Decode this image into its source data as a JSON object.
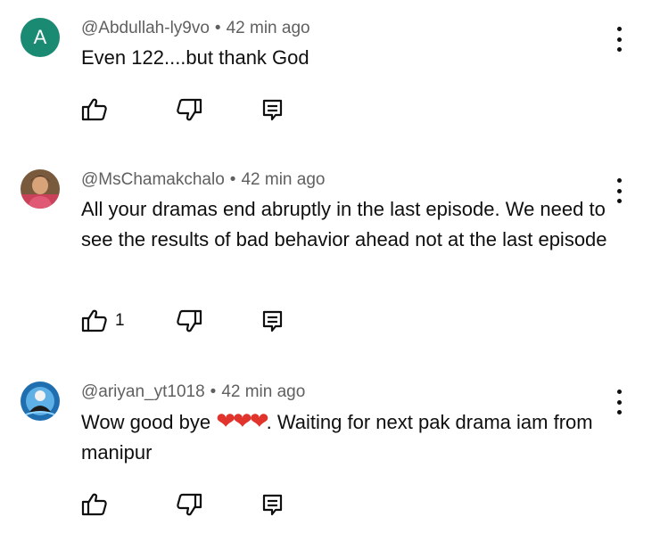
{
  "comments": [
    {
      "avatar_letter": "A",
      "author": "@Abdullah-ly9vo",
      "separator": "•",
      "time": "42 min ago",
      "text": "Even 122....but thank God",
      "like_count": ""
    },
    {
      "avatar_letter": "",
      "author": "@MsChamakchalo",
      "separator": "•",
      "time": "42 min ago",
      "text": "All your dramas end abruptly in the last episode. We need to see the results of bad behavior ahead not at the last episode",
      "like_count": "1"
    },
    {
      "avatar_letter": "",
      "author": "@ariyan_yt1018",
      "separator": "•",
      "time": "42 min ago",
      "text_before": "Wow good bye ",
      "text_hearts": "❤❤❤",
      "text_after": ". Waiting for next pak drama iam from manipur",
      "like_count": ""
    }
  ],
  "colors": {
    "avatar_a": "#1b8a72",
    "meta_text": "#606060",
    "heart": "#e0342c"
  },
  "icons": {
    "like": "thumbs-up-icon",
    "dislike": "thumbs-down-icon",
    "reply": "reply-comment-icon",
    "more": "vertical-ellipsis-icon"
  }
}
